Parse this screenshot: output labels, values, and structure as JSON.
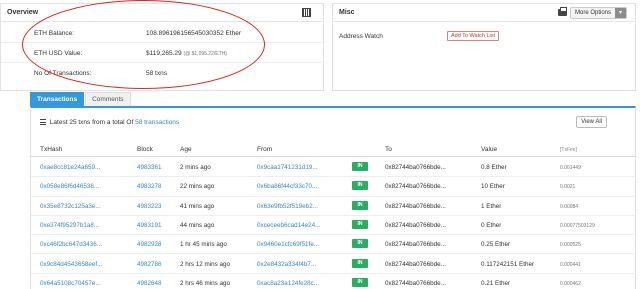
{
  "overview": {
    "title": "Overview",
    "rows": [
      {
        "label": "ETH Balance:",
        "value": "108.896196156545030352 Ether",
        "extra": ""
      },
      {
        "label": "ETH USD Value:",
        "value": "$119,265.29",
        "extra": "(@ $1,095.22/ETH)"
      },
      {
        "label": "No Of Transactions:",
        "value": "58 txns",
        "extra": ""
      }
    ]
  },
  "misc": {
    "title": "Misc",
    "more_options_label": "More Options",
    "address_watch_label": "Address Watch",
    "add_watch_label": "Add To Watch List"
  },
  "tabs": [
    {
      "label": "Transactions"
    },
    {
      "label": "Comments"
    }
  ],
  "transactions": {
    "summary_prefix": "Latest 25 txns from a total Of",
    "summary_link": "58 transactions",
    "view_all_label": "View All",
    "columns": [
      "TxHash",
      "Block",
      "Age",
      "From",
      "",
      "To",
      "Value",
      "[TxFee]"
    ],
    "rows": [
      {
        "hash": "0xae8cc81e24a659...",
        "block": "4983361",
        "age": "2 mins ago",
        "from": "0x9caa1741231d19...",
        "dir": "IN",
        "to": "0x82744ba0766bde...",
        "value": "0.8 Ether",
        "fee": "0.001449"
      },
      {
        "hash": "0x058e86f6d46538...",
        "block": "4983278",
        "age": "22 mins ago",
        "from": "0x6ba86f44cf33c70...",
        "dir": "IN",
        "to": "0x82744ba0766bde...",
        "value": "10 Ether",
        "fee": "0.0021"
      },
      {
        "hash": "0x35e8732c125a3e...",
        "block": "4983223",
        "age": "41 mins ago",
        "from": "0x63e9fb52f519eb2...",
        "dir": "IN",
        "to": "0x82744ba0766bde...",
        "value": "1 Ether",
        "fee": "0.00084"
      },
      {
        "hash": "0xe374f95297b1a8...",
        "block": "4983191",
        "age": "44 mins ago",
        "from": "0xceceeb6cad14e24...",
        "dir": "IN",
        "to": "0x82744ba0766bde...",
        "value": "0 Ether",
        "fee": "0.00077503129"
      },
      {
        "hash": "0xc46f2bc647d3436...",
        "block": "4982928",
        "age": "1 hr 45 mins ago",
        "from": "0x9460e1cfc69f51fe...",
        "dir": "IN",
        "to": "0x82744ba0766bde...",
        "value": "0.25 Ether",
        "fee": "0.000525"
      },
      {
        "hash": "0x9c84d4543658eef...",
        "block": "4982786",
        "age": "2 hrs 12 mins ago",
        "from": "0x2e8432a334f4b7...",
        "dir": "IN",
        "to": "0x82744ba0766bde...",
        "value": "0.117242151 Ether",
        "fee": "0.000441"
      },
      {
        "hash": "0x64a5108c70457e...",
        "block": "4982648",
        "age": "2 hrs 46 mins ago",
        "from": "0xac8a23a124fe28c...",
        "dir": "IN",
        "to": "0x82744ba0766bde...",
        "value": "0.21 Ether",
        "fee": "0.000462"
      }
    ]
  },
  "colors": {
    "accent": "#3498db",
    "in_badge": "#27ae60",
    "link": "#3a87c8",
    "annotation": "#d9261c"
  }
}
